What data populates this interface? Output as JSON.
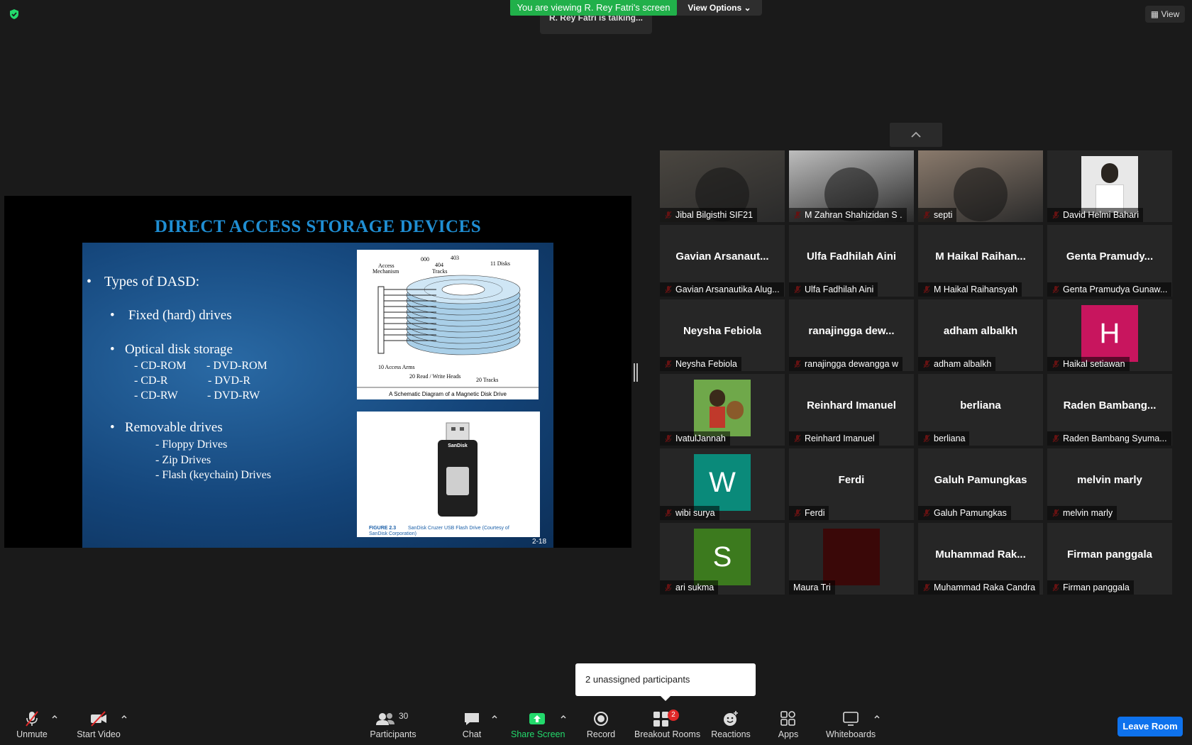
{
  "banner": {
    "viewing": "You are viewing R. Rey Fatri's screen",
    "view_options": "View Options",
    "talking": "R. Rey Fatri is talking...",
    "view": "View"
  },
  "slide": {
    "title": "DIRECT ACCESS STORAGE DEVICES",
    "types": "Types of DASD:",
    "fixed": "Fixed (hard) drives",
    "optical": "Optical disk storage",
    "cd_rom": "- CD-ROM",
    "dvd_rom": "- DVD-ROM",
    "cd_r": "- CD-R",
    "dvd_r": "- DVD-R",
    "cd_rw": "- CD-RW",
    "dvd_rw": "- DVD-RW",
    "removable": "Removable drives",
    "floppy": "- Floppy Drives",
    "zip": "- Zip Drives",
    "flash": "- Flash (keychain) Drives",
    "diagram_caption": "A Schematic Diagram of a Magnetic Disk Drive",
    "diagram_labels": {
      "access": "Access",
      "mechanism": "Mechanism",
      "n000": "000",
      "n404": "404",
      "tracks": "Tracks",
      "n403": "403",
      "disks": "11 Disks",
      "arms": "10 Access Arms",
      "heads": "20 Read / Write Heads",
      "tracks20": "20 Tracks"
    },
    "usb_brand": "SanDisk",
    "figure_label": "FIGURE 2.3",
    "figure_caption": "SanDisk Cruzer USB Flash Drive (Courtesy of",
    "figure_caption2": "SanDisk Corporation)",
    "page": "2-18"
  },
  "participants": [
    {
      "name": "Jibal Bilgisthi SIF21",
      "big": "",
      "type": "video",
      "color": "#4a4640",
      "muted": true
    },
    {
      "name": "M Zahran Shahizidan S .",
      "big": "",
      "type": "video",
      "color": "#bdbdbd",
      "muted": true
    },
    {
      "name": "septi",
      "big": "",
      "type": "video",
      "color": "#8a7a6c",
      "muted": true
    },
    {
      "name": "David Helmi Bahari",
      "big": "",
      "type": "photo",
      "color": "#e8e8e8",
      "muted": true
    },
    {
      "name": "Gavian Arsanautika Alug...",
      "big": "Gavian  Arsanaut...",
      "type": "text",
      "muted": true
    },
    {
      "name": "Ulfa Fadhilah Aini",
      "big": "Ulfa Fadhilah Aini",
      "type": "text",
      "muted": true
    },
    {
      "name": "M Haikal Raihansyah",
      "big": "M  Haikal  Raihan...",
      "type": "text",
      "muted": true
    },
    {
      "name": "Genta Pramudya Gunaw...",
      "big": "Genta  Pramudy...",
      "type": "text",
      "muted": true
    },
    {
      "name": "Neysha Febiola",
      "big": "Neysha Febiola",
      "type": "text",
      "muted": true
    },
    {
      "name": "ranajingga dewangga w",
      "big": "ranajingga  dew...",
      "type": "text",
      "muted": true
    },
    {
      "name": "adham albalkh",
      "big": "adham albalkh",
      "type": "text",
      "muted": true
    },
    {
      "name": "Haikal setiawan",
      "big": "",
      "type": "letter",
      "letter": "H",
      "color": "#c8155e",
      "muted": true
    },
    {
      "name": "IvatulJannah",
      "big": "",
      "type": "cartoon",
      "color": "#6fa84a",
      "muted": true
    },
    {
      "name": "Reinhard Imanuel",
      "big": "Reinhard Imanuel",
      "type": "text",
      "muted": true
    },
    {
      "name": "berliana",
      "big": "berliana",
      "type": "text",
      "muted": true
    },
    {
      "name": "Raden Bambang Syuma...",
      "big": "Raden  Bambang...",
      "type": "text",
      "muted": true
    },
    {
      "name": "wibi surya",
      "big": "",
      "type": "letter",
      "letter": "W",
      "color": "#0a8a7a",
      "muted": true
    },
    {
      "name": "Ferdi",
      "big": "Ferdi",
      "type": "text",
      "muted": true
    },
    {
      "name": "Galuh Pamungkas",
      "big": "Galuh Pamungkas",
      "type": "text",
      "muted": true
    },
    {
      "name": "melvin marly",
      "big": "melvin marly",
      "type": "text",
      "muted": true
    },
    {
      "name": "ari sukma",
      "big": "",
      "type": "letter",
      "letter": "S",
      "color": "#3c7a1e",
      "muted": true
    },
    {
      "name": "Maura Tri",
      "big": "",
      "type": "dark",
      "color": "#3a0808",
      "muted": false
    },
    {
      "name": "Muhammad Raka Candra",
      "big": "Muhammad  Rak...",
      "type": "text",
      "muted": true
    },
    {
      "name": "Firman panggala",
      "big": "Firman panggala",
      "type": "text",
      "muted": true
    }
  ],
  "unassigned": "2 unassigned participants",
  "toolbar": {
    "unmute": "Unmute",
    "start_video": "Start Video",
    "participants": "Participants",
    "participants_count": "30",
    "chat": "Chat",
    "share_screen": "Share Screen",
    "record": "Record",
    "breakout": "Breakout Rooms",
    "breakout_badge": "2",
    "reactions": "Reactions",
    "apps": "Apps",
    "whiteboards": "Whiteboards",
    "leave": "Leave Room"
  }
}
